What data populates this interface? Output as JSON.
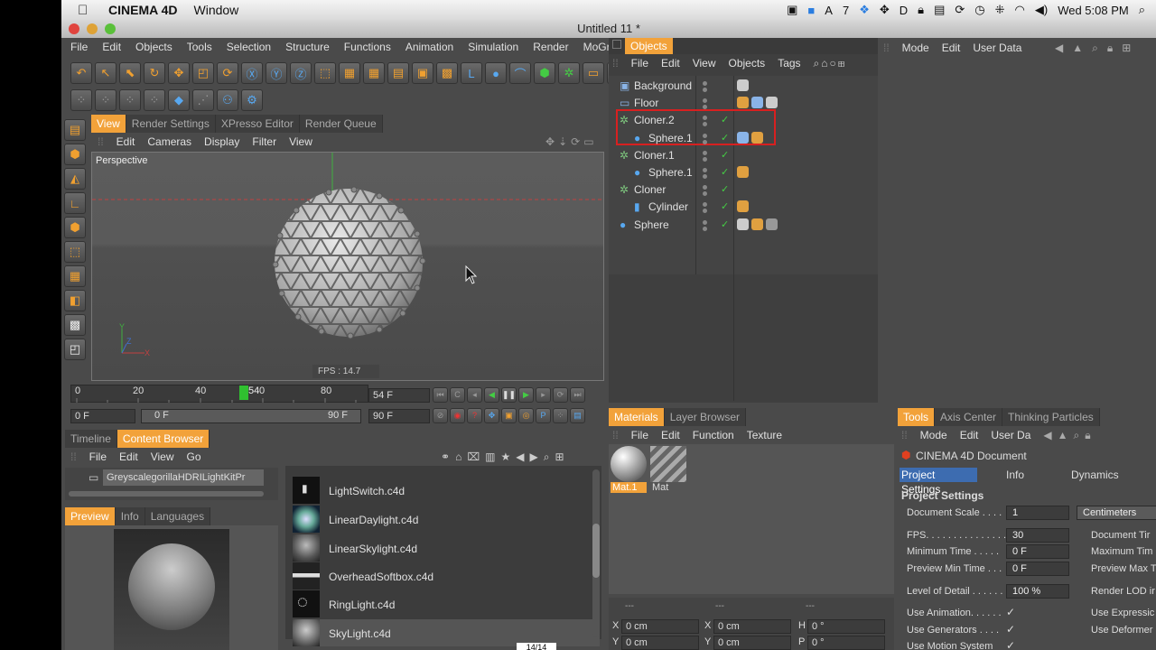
{
  "mac_menubar": {
    "app_name": "CINEMA 4D",
    "menu_window": "Window",
    "clock": "Wed 5:08 PM",
    "tray_count": "7"
  },
  "window": {
    "title": "Untitled 11 *"
  },
  "main_menu": [
    "File",
    "Edit",
    "Objects",
    "Tools",
    "Selection",
    "Structure",
    "Functions",
    "Animation",
    "Simulation",
    "Render",
    "MoGr"
  ],
  "viewport_tabs": [
    "View",
    "Render Settings",
    "XPresso Editor",
    "Render Queue"
  ],
  "viewport_menu": [
    "Edit",
    "Cameras",
    "Display",
    "Filter",
    "View"
  ],
  "viewport": {
    "label": "Perspective",
    "fps": "FPS : 14.7"
  },
  "timeline": {
    "ticks": [
      "0",
      "20",
      "40",
      "0",
      "80"
    ],
    "current_frame": "54",
    "current_field": "54 F",
    "start_field": "0 F",
    "range_start": "0 F",
    "range_end": "90 F",
    "end_field": "90 F"
  },
  "objects_panel": {
    "title": "Objects",
    "menu": [
      "File",
      "Edit",
      "View",
      "Objects",
      "Tags"
    ],
    "items": [
      {
        "name": "Background",
        "indent": 0
      },
      {
        "name": "Floor",
        "indent": 0
      },
      {
        "name": "Cloner.2",
        "indent": 0
      },
      {
        "name": "Sphere.1",
        "indent": 1
      },
      {
        "name": "Cloner.1",
        "indent": 0
      },
      {
        "name": "Sphere.1",
        "indent": 1
      },
      {
        "name": "Cloner",
        "indent": 0
      },
      {
        "name": "Cylinder",
        "indent": 1
      },
      {
        "name": "Sphere",
        "indent": 0
      }
    ]
  },
  "attributes_panel": {
    "menu": [
      "Mode",
      "Edit",
      "User Data"
    ]
  },
  "materials_panel": {
    "tabs": [
      "Materials",
      "Layer Browser"
    ],
    "menu": [
      "File",
      "Edit",
      "Function",
      "Texture"
    ],
    "materials": [
      "Mat.1",
      "Mat"
    ],
    "coords": [
      {
        "label": "X",
        "value": "0 cm"
      },
      {
        "label": "X",
        "value": "0 cm"
      },
      {
        "label": "H",
        "value": "0 °"
      },
      {
        "label": "Y",
        "value": "0 cm"
      },
      {
        "label": "Y",
        "value": "0 cm"
      },
      {
        "label": "P",
        "value": "0 °"
      }
    ],
    "dashes": "---"
  },
  "tools_panel": {
    "tabs": [
      "Tools",
      "Axis Center",
      "Thinking Particles"
    ],
    "menu": [
      "Mode",
      "Edit",
      "User Da"
    ],
    "doc_title": "CINEMA 4D Document",
    "subtabs": [
      "Project Settings",
      "Info",
      "Dynamics"
    ],
    "section": "Project Settings",
    "document_scale_label": "Document Scale . . . .",
    "document_scale": "1",
    "unit": "Centimeters",
    "fps_label": "FPS. . . . . . . . . . . . . . .",
    "fps": "30",
    "min_time_label": "Minimum Time . . . . .",
    "min_time": "0 F",
    "preview_min_label": "Preview Min Time . . .",
    "preview_min": "0 F",
    "lod_label": "Level of Detail . . . . . .",
    "lod": "100 %",
    "right_labels": [
      "Document Tir",
      "Maximum Tim",
      "Preview Max T",
      "Render LOD ir",
      "Use Expressic",
      "Use Deformer"
    ],
    "use_animation": "Use Animation. . . . . .",
    "use_generators": "Use Generators . . . .",
    "use_motion": "Use Motion System"
  },
  "browser": {
    "tabs": [
      "Timeline",
      "Content Browser"
    ],
    "menu": [
      "File",
      "Edit",
      "View",
      "Go"
    ],
    "path": "GreyscalegorillaHDRILightKitPr",
    "preview_tabs": [
      "Preview",
      "Info",
      "Languages"
    ],
    "files": [
      "LightSwitch.c4d",
      "LinearDaylight.c4d",
      "LinearSkylight.c4d",
      "OverheadSoftbox.c4d",
      "RingLight.c4d",
      "SkyLight.c4d"
    ],
    "bottom_counter": "14/14"
  },
  "colors": {
    "accent": "#f2a23a",
    "selection_box": "#e02020",
    "check": "#44cc44"
  }
}
